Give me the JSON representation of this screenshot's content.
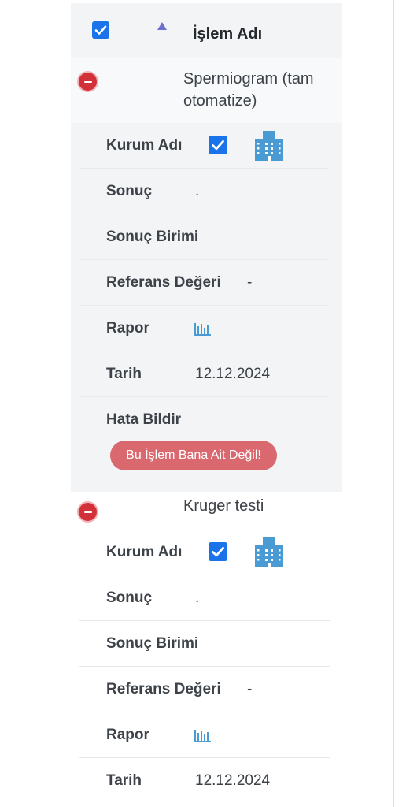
{
  "header": {
    "title": "İşlem Adı",
    "select_all_checked": true
  },
  "labels": {
    "kurum_adi": "Kurum Adı",
    "sonuc": "Sonuç",
    "sonuc_birimi": "Sonuç Birimi",
    "referans_degeri": "Referans Değeri",
    "rapor": "Rapor",
    "tarih": "Tarih",
    "hata_bildir": "Hata Bildir"
  },
  "records": [
    {
      "name": "Spermiogram (tam otomatize)",
      "kurum_checked": true,
      "sonuc": ".",
      "sonuc_birimi": "",
      "referans_degeri": "-",
      "tarih": "12.12.2024",
      "error_button_label": "Bu İşlem Bana Ait Değil!"
    },
    {
      "name": "Kruger testi",
      "kurum_checked": true,
      "sonuc": ".",
      "sonuc_birimi": "",
      "referans_degeri": "-",
      "tarih": "12.12.2024"
    }
  ],
  "colors": {
    "checkbox": "#1a73e8",
    "minus": "#d3313a",
    "error_button": "#d9686f",
    "icon_blue": "#4a9ad4"
  },
  "icons": {
    "sort": "sort-up-triangle-icon",
    "collapse": "minus-circle-icon",
    "institution": "hospital-building-icon",
    "report": "bar-chart-icon"
  }
}
